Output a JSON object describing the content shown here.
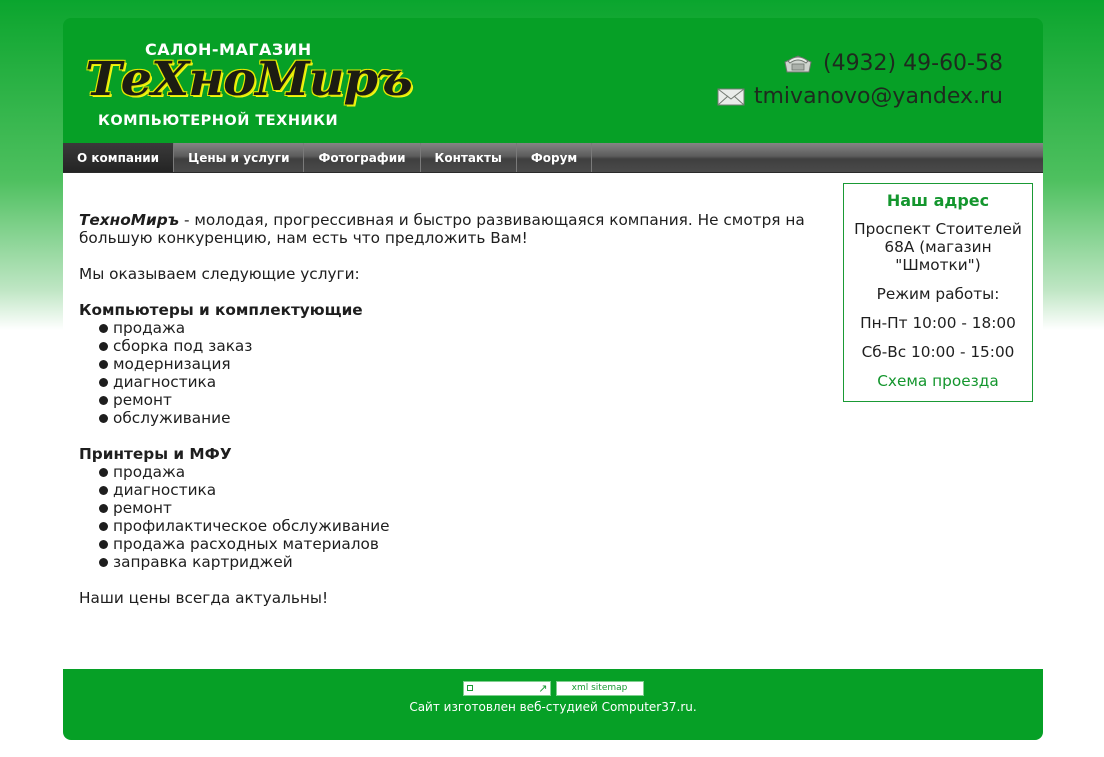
{
  "header": {
    "logo_top": "САЛОН-МАГАЗИН",
    "logo_main": "ТеХноМиръ",
    "logo_bottom": "КОМПЬЮТЕРНОЙ ТЕХНИКИ",
    "phone": "(4932) 49-60-58",
    "email": "tmivanovo@yandex.ru",
    "phone_icon": "fax-phone-icon",
    "email_icon": "envelope-icon"
  },
  "nav": {
    "items": [
      {
        "label": "О компании"
      },
      {
        "label": "Цены и услуги"
      },
      {
        "label": "Фотографии"
      },
      {
        "label": "Контакты"
      },
      {
        "label": "Форум"
      }
    ]
  },
  "main": {
    "intro_brand": "ТехноМиръ",
    "intro_text": " - молодая, прогрессивная и быстро развивающаяся компания. Не смотря на большую конкуренцию, нам есть что предложить Вам!",
    "services_title": "Мы оказываем следующие услуги:",
    "groups": [
      {
        "title": "Компьютеры и комплектующие",
        "items": [
          "продажа",
          "сборка под заказ",
          "модернизация",
          "диагностика",
          "ремонт",
          "обслуживание"
        ]
      },
      {
        "title": "Принтеры и МФУ",
        "items": [
          "продажа",
          "диагностика",
          "ремонт",
          "профилактическое обслуживание",
          "продажа расходных материалов",
          "заправка картриджей"
        ]
      }
    ],
    "closing": "Наши цены всегда актуальны!"
  },
  "sidebar": {
    "title": "Наш адрес",
    "address": "Проспект Стоителей 68А (магазин \"Шмотки\")",
    "hours_label": "Режим работы:",
    "weekdays": "Пн-Пт 10:00 - 18:00",
    "weekend": "Сб-Вс 10:00 - 15:00",
    "map_link": "Схема проезда"
  },
  "footer": {
    "sitemap_badge": "xml sitemap",
    "credit": "Сайт изготовлен веб-студией Computer37.ru."
  },
  "colors": {
    "brand_green": "#06a026",
    "link_green": "#14962e",
    "nav_dark": "#4a4a4a"
  }
}
